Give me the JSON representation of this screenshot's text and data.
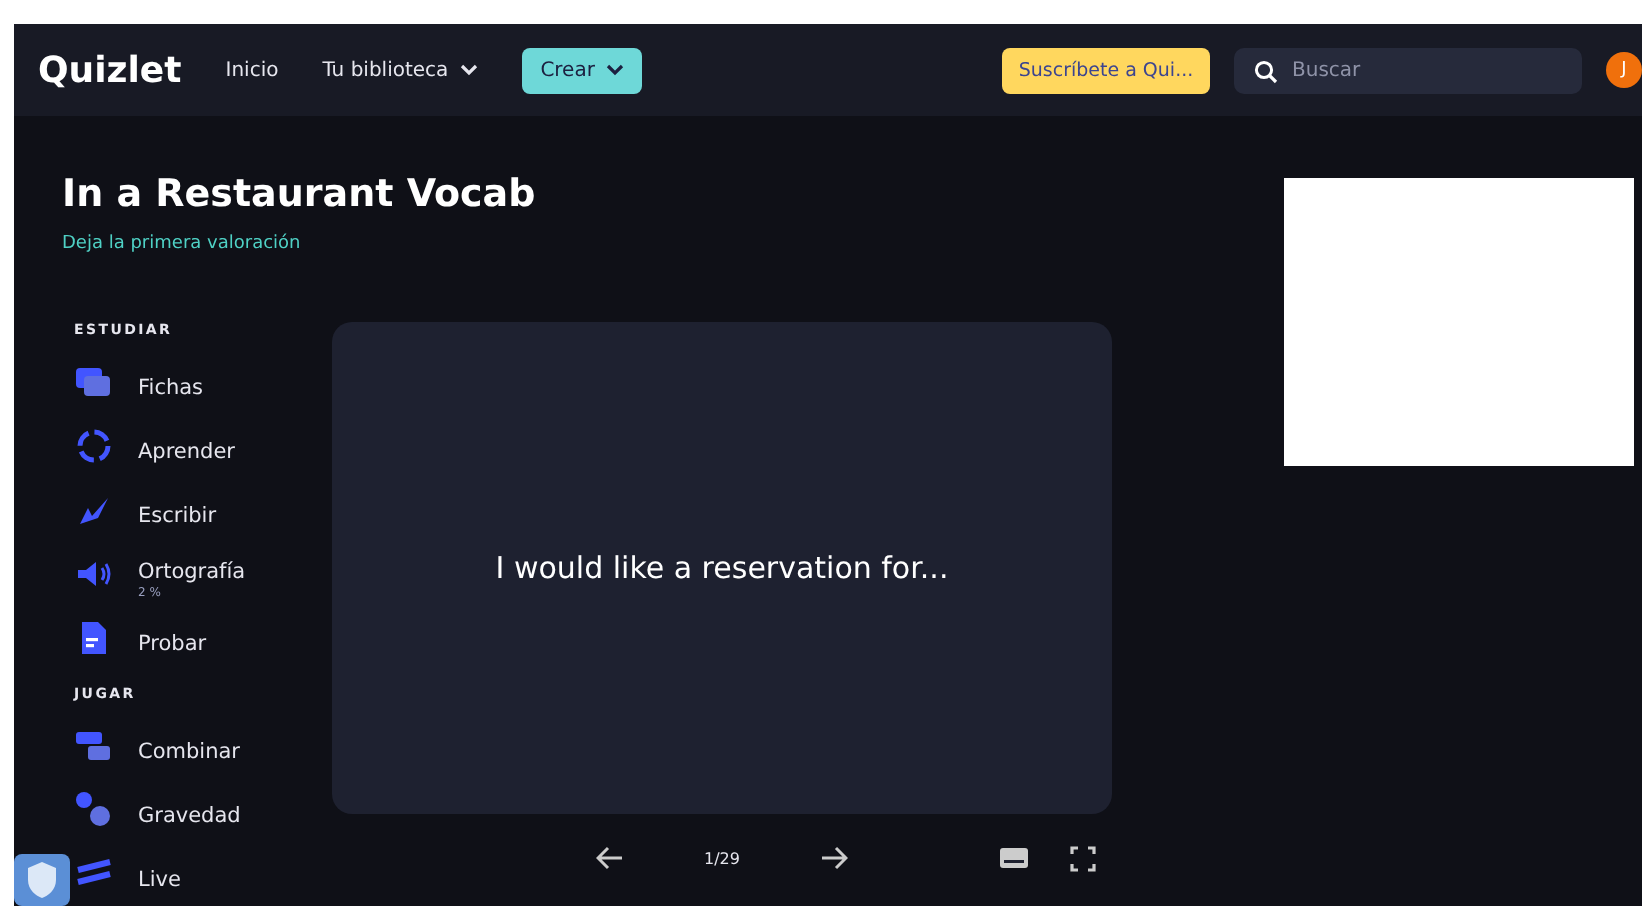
{
  "header": {
    "logo": "Quizlet",
    "nav": [
      {
        "label": "Inicio",
        "dropdown": false
      },
      {
        "label": "Tu biblioteca",
        "dropdown": true
      }
    ],
    "create": "Crear",
    "subscribe": "Suscríbete a Qui...",
    "search": {
      "placeholder": "Buscar"
    },
    "avatar": "J"
  },
  "set": {
    "title": "In a Restaurant Vocab",
    "rating": "Deja la primera valoración"
  },
  "sections": [
    {
      "heading": "ESTUDIAR",
      "items": [
        {
          "kind": "cards",
          "label": "Fichas"
        },
        {
          "kind": "learn",
          "label": "Aprender"
        },
        {
          "kind": "write",
          "label": "Escribir"
        },
        {
          "kind": "spell",
          "label": "Ortografía",
          "sub": "2 %"
        },
        {
          "kind": "test",
          "label": "Probar"
        }
      ]
    },
    {
      "heading": "JUGAR",
      "items": [
        {
          "kind": "match",
          "label": "Combinar"
        },
        {
          "kind": "gravity",
          "label": "Gravedad"
        },
        {
          "kind": "live",
          "label": "Live"
        }
      ]
    }
  ],
  "card": {
    "text": "I would like a reservation for..."
  },
  "controls": {
    "counter": "1/29"
  }
}
